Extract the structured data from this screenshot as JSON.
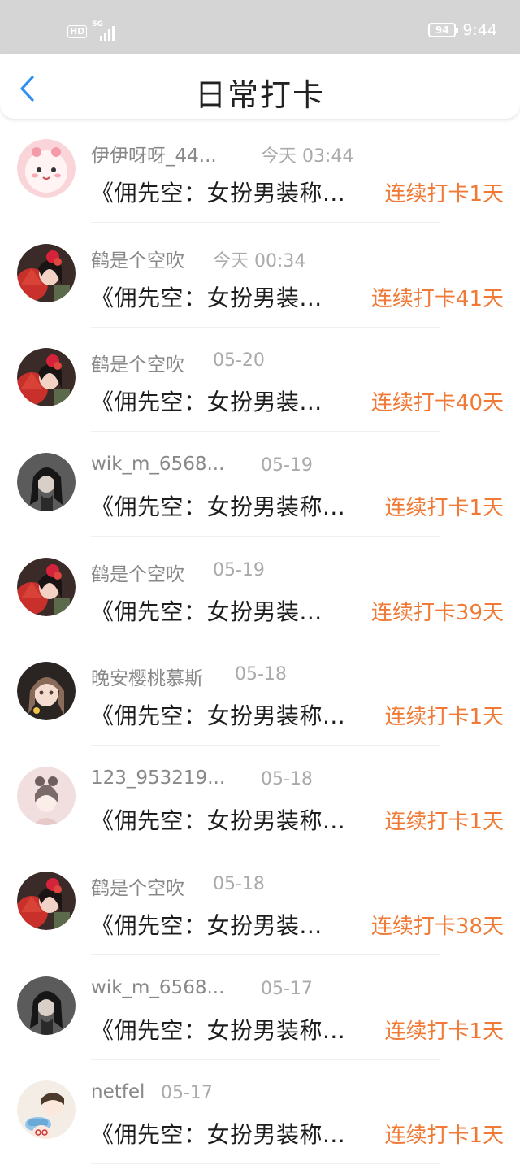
{
  "status_bar": {
    "hd": "HD",
    "net": "5G",
    "battery": "94",
    "time": "9:44"
  },
  "header": {
    "title": "日常打卡"
  },
  "colors": {
    "accent": "#f07a35",
    "back_arrow": "#2f8ff5"
  },
  "checkins": [
    {
      "user": "伊伊呀呀_44...",
      "when": "今天 03:44",
      "content": "《佣先空：女扮男装称...",
      "streak": "连续打卡1天",
      "avatar": "pink-cartoon-avatar"
    },
    {
      "user": "鹤是个空吹",
      "when": "今天 00:34",
      "content": "《佣先空：女扮男装...",
      "streak": "连续打卡41天",
      "avatar": "red-fan-girl-avatar"
    },
    {
      "user": "鹤是个空吹",
      "when": "05-20",
      "content": "《佣先空：女扮男装...",
      "streak": "连续打卡40天",
      "avatar": "red-fan-girl-avatar"
    },
    {
      "user": "wik_m_6568...",
      "when": "05-19",
      "content": "《佣先空：女扮男装称...",
      "streak": "连续打卡1天",
      "avatar": "dark-hair-girl-avatar"
    },
    {
      "user": "鹤是个空吹",
      "when": "05-19",
      "content": "《佣先空：女扮男装...",
      "streak": "连续打卡39天",
      "avatar": "red-fan-girl-avatar"
    },
    {
      "user": "晚安樱桃慕斯",
      "when": "05-18",
      "content": "《佣先空：女扮男装称...",
      "streak": "连续打卡1天",
      "avatar": "anime-girl-avatar"
    },
    {
      "user": "123_953219...",
      "when": "05-18",
      "content": "《佣先空：女扮男装称...",
      "streak": "连续打卡1天",
      "avatar": "pastel-girl-avatar"
    },
    {
      "user": "鹤是个空吹",
      "when": "05-18",
      "content": "《佣先空：女扮男装...",
      "streak": "连续打卡38天",
      "avatar": "red-fan-girl-avatar"
    },
    {
      "user": "wik_m_6568...",
      "when": "05-17",
      "content": "《佣先空：女扮男装称...",
      "streak": "连续打卡1天",
      "avatar": "dark-hair-girl-avatar"
    },
    {
      "user": "netfel",
      "when": "05-17",
      "content": "《佣先空：女扮男装称...",
      "streak": "连续打卡1天",
      "avatar": "anime-boy-blue-hat-avatar"
    }
  ]
}
